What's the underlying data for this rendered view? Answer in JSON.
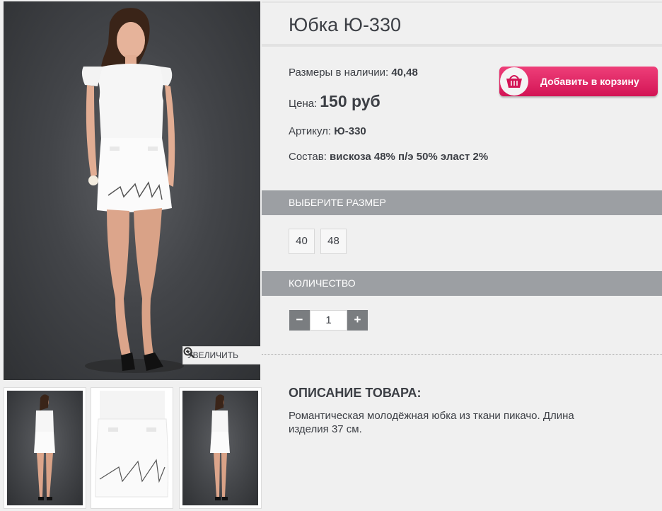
{
  "product": {
    "title": "Юбка Ю-330",
    "sizes_label": "Размеры в наличии:",
    "sizes_value": "40,48",
    "price_label": "Цена:",
    "price_value": "150 руб",
    "article_label": "Артикул:",
    "article_value": "Ю-330",
    "composition_label": "Состав:",
    "composition_value": "вискоза 48% п/э 50% эласт 2%"
  },
  "gallery": {
    "zoom_label": "УВЕЛИЧИТЬ",
    "thumbnails": [
      "full-length front",
      "skirt close-up",
      "full-length side"
    ]
  },
  "cart_button": {
    "label": "Добавить в корзину"
  },
  "size_section": {
    "heading": "ВЫБЕРИТЕ РАЗМЕР",
    "options": [
      "40",
      "48"
    ]
  },
  "quantity_section": {
    "heading": "КОЛИЧЕСТВО",
    "minus": "−",
    "plus": "+",
    "value": "1"
  },
  "description": {
    "heading": "ОПИСАНИЕ ТОВАРА:",
    "text": "Романтическая молодёжная юбка из ткани пикачо. Длина изделия 37 см."
  },
  "colors": {
    "accent": "#d31455",
    "section_bg": "#9c9fa3",
    "qty_buttons": "#7a7d80",
    "page_bg": "#f0f0f0"
  }
}
